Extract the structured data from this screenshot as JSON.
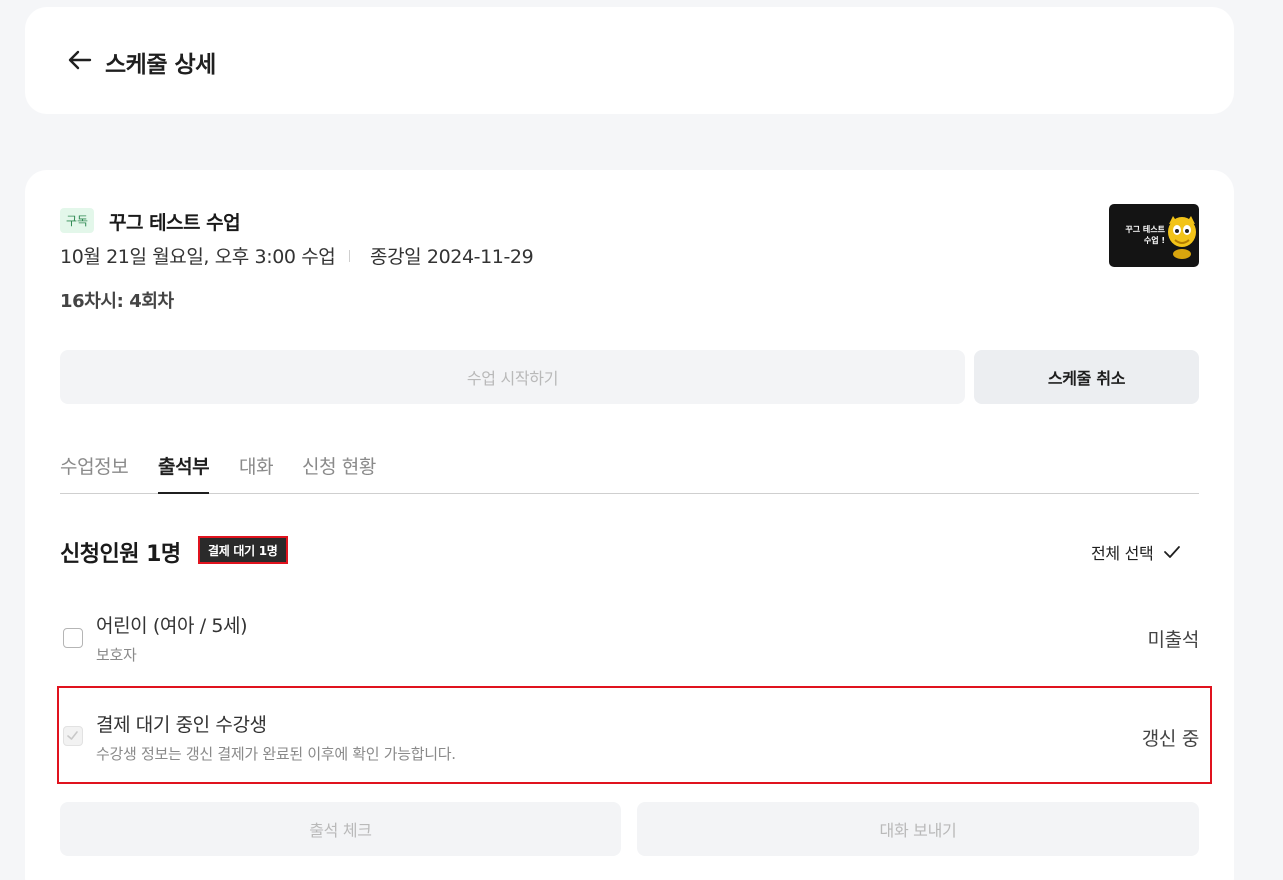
{
  "header": {
    "title": "스케줄 상세",
    "back_icon": "arrow-left-icon"
  },
  "class": {
    "badge": "구독",
    "title": "꾸그 테스트 수업",
    "date": "10월 21일 월요일, 오후 3:00 수업",
    "end_date": "종강일 2024-11-29",
    "session": "16차시: 4회차",
    "thumbnail_text_line1": "꾸그 테스트",
    "thumbnail_text_line2": "수업 !"
  },
  "actions": {
    "start_label": "수업 시작하기",
    "cancel_label": "스케줄 취소"
  },
  "tabs": [
    {
      "label": "수업정보",
      "active": false
    },
    {
      "label": "출석부",
      "active": true
    },
    {
      "label": "대화",
      "active": false
    },
    {
      "label": "신청 현황",
      "active": false
    }
  ],
  "attendance": {
    "count_title": "신청인원 1명",
    "pending_badge": "결제 대기 1명",
    "select_all": "전체 선택",
    "students": [
      {
        "name": "어린이 (여아 / 5세)",
        "sub": "보호자",
        "status": "미출석",
        "checked": false,
        "disabled": false
      },
      {
        "name": "결제 대기 중인 수강생",
        "sub": "수강생 정보는 갱신 결제가 완료된 이후에 확인 가능합니다.",
        "status": "갱신 중",
        "checked": true,
        "disabled": true
      }
    ],
    "attend_check_label": "출석 체크",
    "send_message_label": "대화 보내기"
  },
  "colors": {
    "background": "#f5f6f8",
    "card": "#ffffff",
    "highlight_red": "#e0131e",
    "badge_green_bg": "#e3f7ea",
    "badge_green_text": "#2f8a53"
  }
}
